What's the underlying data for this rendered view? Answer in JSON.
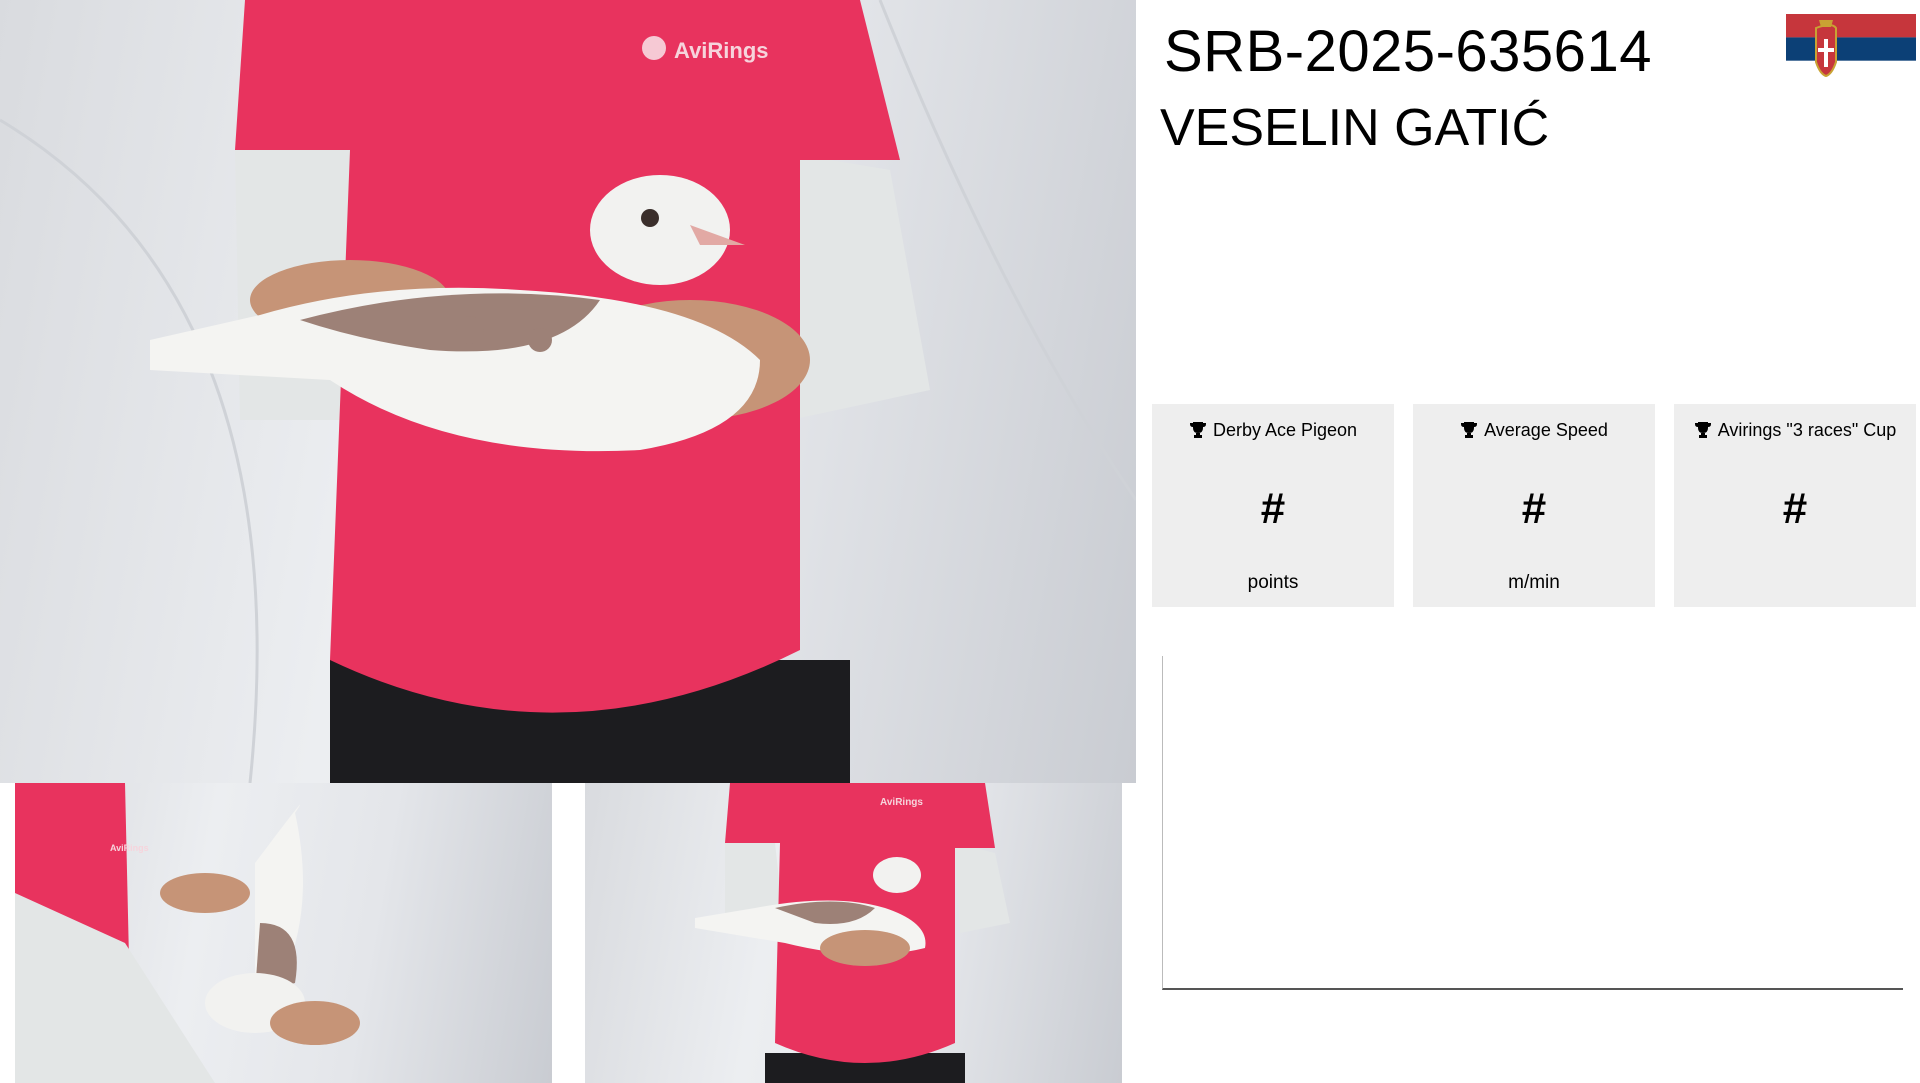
{
  "bird": {
    "ring_id": "SRB-2025-635614",
    "owner": "VESELIN GATIĆ",
    "country_flag": "serbia-flag-icon"
  },
  "photos": {
    "shirt_logo": "AviRings"
  },
  "stats": [
    {
      "title": "Derby Ace Pigeon",
      "value": "#",
      "unit": "points",
      "icon": "trophy-icon"
    },
    {
      "title": "Average Speed",
      "value": "#",
      "unit": "m/min",
      "icon": "trophy-icon"
    },
    {
      "title": "Avirings \"3 races\" Cup",
      "value": "#",
      "unit": "",
      "icon": "trophy-icon"
    }
  ],
  "colors": {
    "shirt": "#e8335e",
    "card_bg": "#eeeeee",
    "flag_red": "#c6363c",
    "flag_blue": "#0c4076"
  }
}
